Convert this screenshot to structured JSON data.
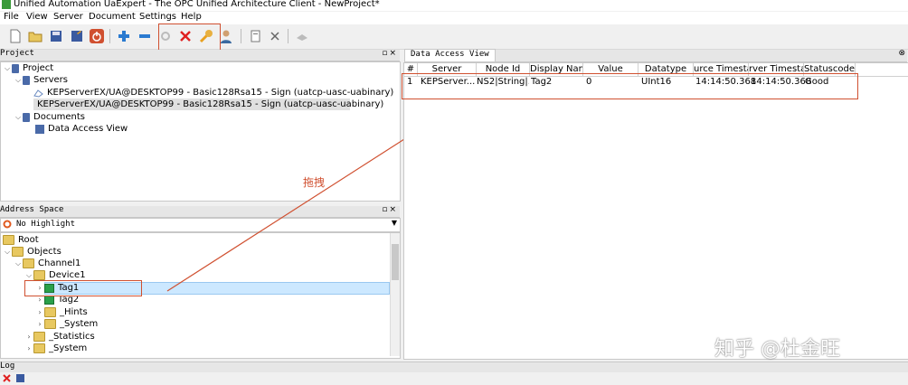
{
  "window": {
    "title": "Unified Automation UaExpert - The OPC Unified Architecture Client - NewProject*"
  },
  "menu": [
    "File",
    "View",
    "Server",
    "Document",
    "Settings",
    "Help"
  ],
  "toolbar": {
    "icons": [
      "new-document-icon",
      "open-folder-icon",
      "save-icon",
      "save-as-icon",
      "power-icon",
      "add-server-icon",
      "remove-server-icon",
      "connect-icon",
      "disconnect-icon",
      "settings-wrench-icon",
      "user-icon",
      "add-document-icon",
      "remove-document-icon",
      "unknown-icon"
    ]
  },
  "project_panel": {
    "title": "Project",
    "tree": {
      "root": "Project",
      "servers_label": "Servers",
      "servers": [
        "KEPServerEX/UA@DESKTOP99 - Basic128Rsa15 - Sign (uatcp-uasc-uabinary)",
        "KEPServerEX/UA@DESKTOP99 - Basic128Rsa15 - Sign (uatcp-uasc-uabinary)"
      ],
      "documents_label": "Documents",
      "documents": [
        "Data Access View"
      ]
    }
  },
  "annotation": {
    "text": "拖拽"
  },
  "address_space": {
    "title": "Address Space",
    "highlight": "No Highlight",
    "tree": {
      "root": "Root",
      "objects": "Objects",
      "channel": "Channel1",
      "device": "Device1",
      "tag1": "Tag1",
      "tag2": "Tag2",
      "hints": "_Hints",
      "system_dev": "_System",
      "statistics": "_Statistics",
      "system_ch": "_System"
    }
  },
  "data_access_view": {
    "tab_label": "Data Access View",
    "columns": [
      "#",
      "Server",
      "Node Id",
      "Display Name",
      "Value",
      "Datatype",
      "Source Timestamp",
      "Server Timestamp",
      "Statuscode"
    ],
    "columns_visible": [
      "#",
      "Server",
      "Node Id",
      "Display Name",
      "Value",
      "Datatype",
      "urce Timesta",
      "rver Timestar",
      "Statuscode"
    ],
    "rows": [
      {
        "index": "1",
        "server": "KEPServer...",
        "node_id": "NS2|String|...",
        "display_name": "Tag2",
        "value": "0",
        "datatype": "UInt16",
        "source_ts": "14:14:50.368",
        "server_ts": "14:14:50.368",
        "status": "Good"
      }
    ]
  },
  "log_panel": {
    "title": "Log"
  },
  "watermark": "知乎 @杜金旺",
  "colors": {
    "annotation_red": "#d05030",
    "selection_blue": "#cce8ff",
    "tag_green": "#2aa04a"
  }
}
